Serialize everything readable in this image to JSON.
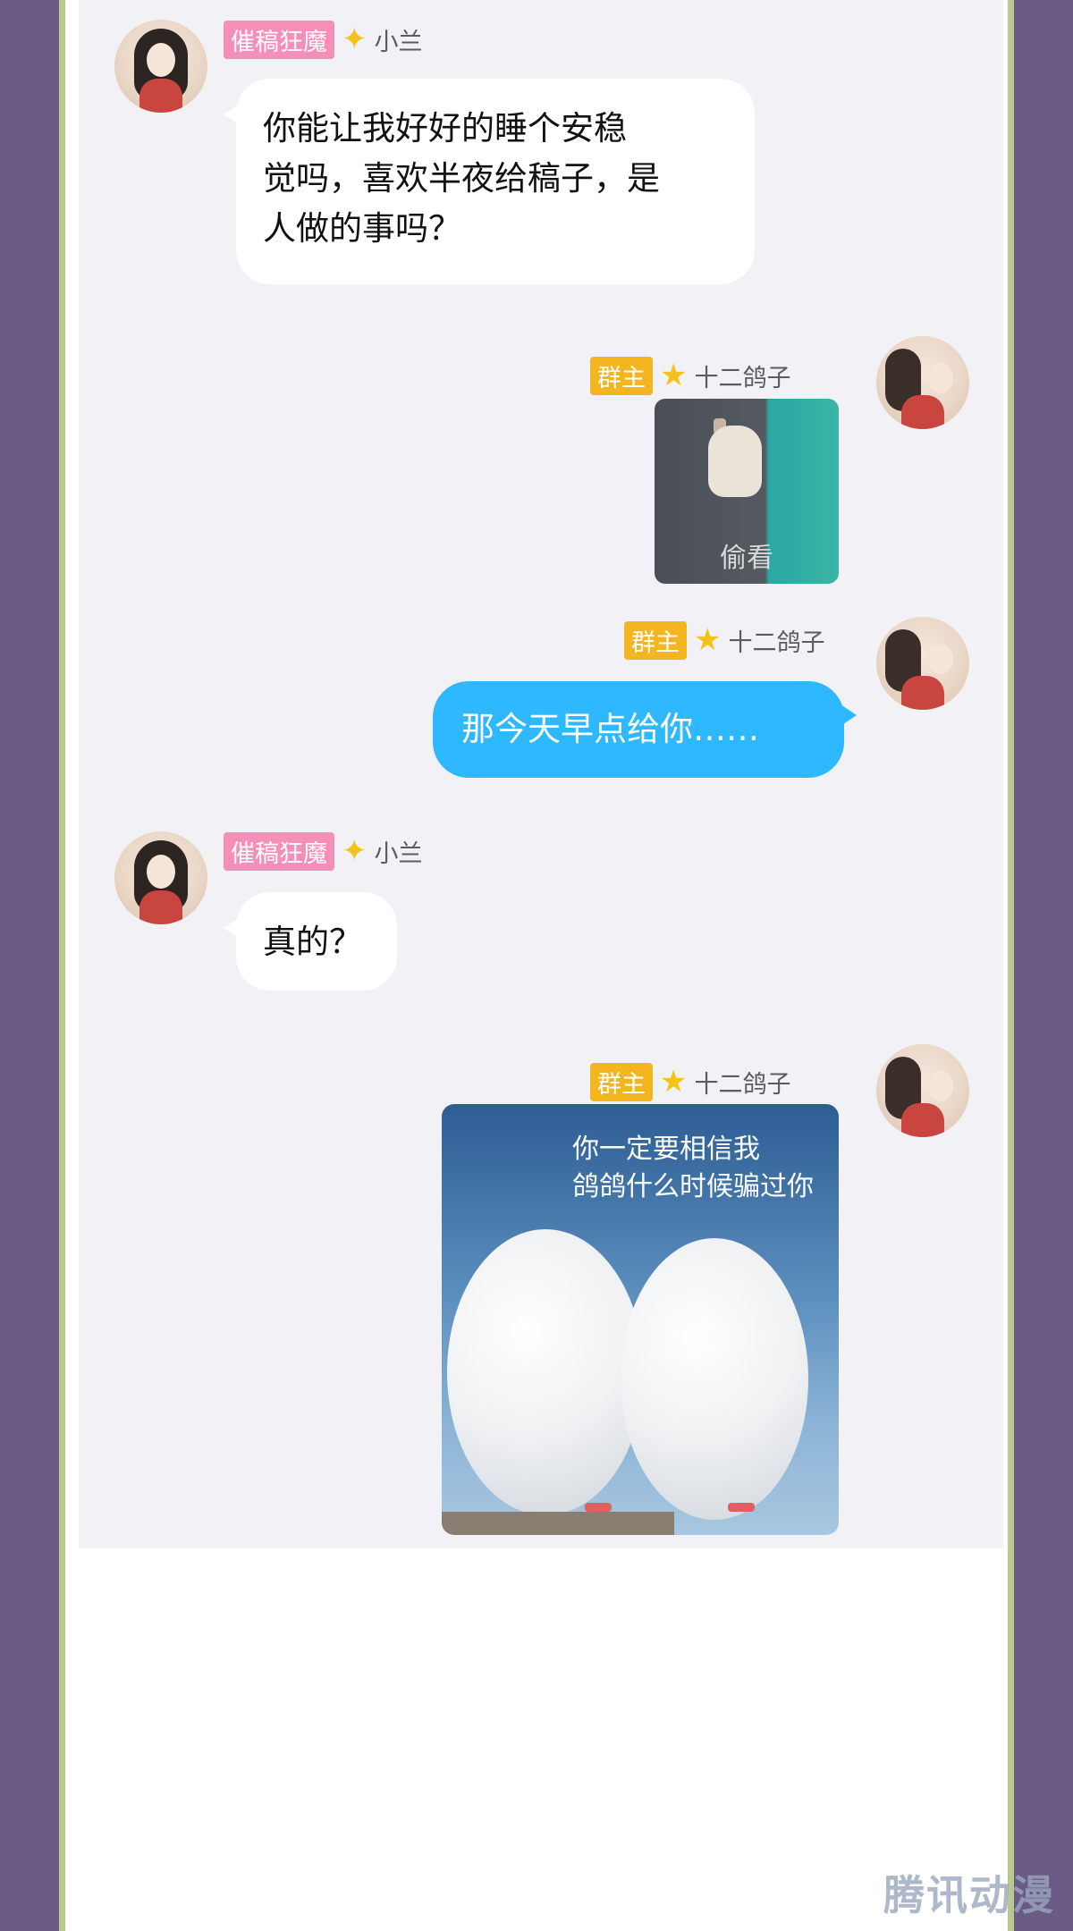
{
  "messages": [
    {
      "side": "left",
      "badge": "催稿狂魔",
      "name": "小兰",
      "text_lines": [
        "你能让我好好的睡个安稳",
        "觉吗，喜欢半夜给稿子，是",
        "人做的事吗？"
      ]
    },
    {
      "side": "right",
      "badge": "群主",
      "name": "十二鸽子",
      "image_caption": "偷看"
    },
    {
      "side": "right",
      "badge": "群主",
      "name": "十二鸽子",
      "text": "那今天早点给你……"
    },
    {
      "side": "left",
      "badge": "催稿狂魔",
      "name": "小兰",
      "text": "真的？"
    },
    {
      "side": "right",
      "badge": "群主",
      "name": "十二鸽子",
      "image_caption_lines": [
        "你一定要相信我",
        "鸽鸽什么时候骗过你"
      ]
    }
  ],
  "watermark": "腾讯动漫",
  "colors": {
    "outer": "#6a5a86",
    "frame_border": "#b9c98e",
    "chat_bg": "#f1f1f6",
    "bubble_left": "#ffffff",
    "bubble_right": "#2db8ff",
    "badge_pink": "#f58fb9",
    "badge_yellow": "#f3b520"
  },
  "icons": {
    "badge_star_left": "sparkle-star-icon",
    "badge_star_right": "star-icon"
  }
}
